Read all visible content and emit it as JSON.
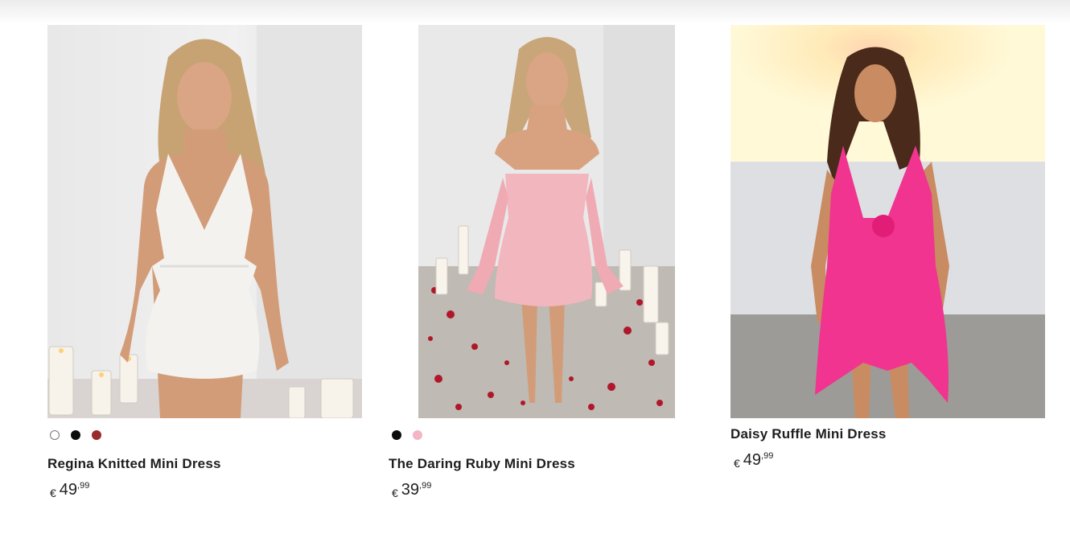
{
  "products": [
    {
      "name": "Regina Knitted Mini Dress",
      "price_currency": "€",
      "price_int": "49",
      "price_cents": ",99",
      "swatches": [
        "#ffffff",
        "#0c0c0c",
        "#9b2a2a"
      ],
      "image_desc": "model-in-white-knitted-dress"
    },
    {
      "name": "The Daring Ruby Mini Dress",
      "price_currency": "€",
      "price_int": "39",
      "price_cents": ",99",
      "swatches": [
        "#0c0c0c",
        "#f2b6c6"
      ],
      "image_desc": "model-in-pink-off-shoulder-dress"
    },
    {
      "name": "Daisy Ruffle Mini Dress",
      "price_currency": "€",
      "price_int": "49",
      "price_cents": ",99",
      "swatches": [],
      "image_desc": "model-in-hot-pink-ruffle-dress"
    }
  ]
}
